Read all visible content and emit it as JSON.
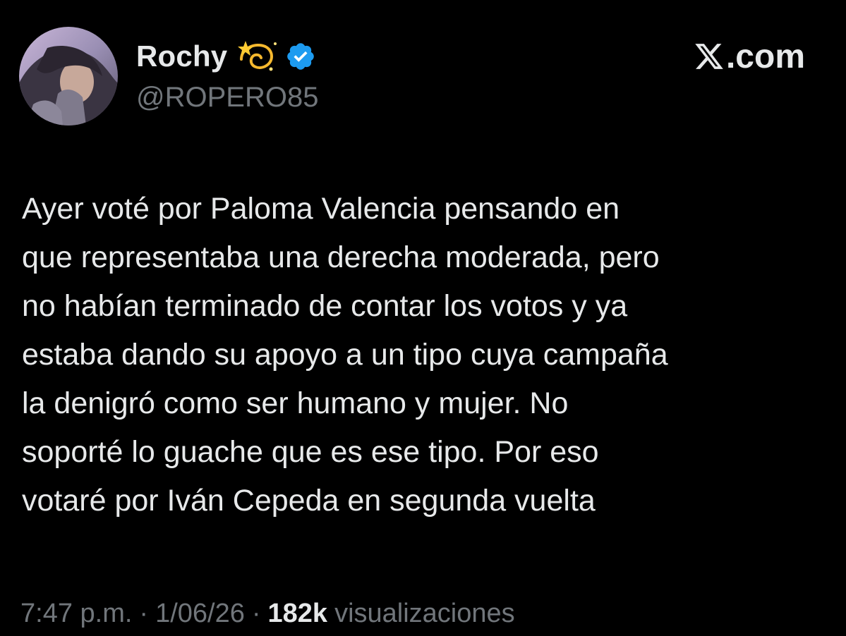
{
  "user": {
    "display_name": "Rochy",
    "handle": "@ROPERO85",
    "emoji_icon": "dizzy-star-emoji",
    "verified": true,
    "verified_color": "#1d9bf0"
  },
  "brand": {
    "label": ".com",
    "icon": "x-logo-icon"
  },
  "tweet": {
    "text": "Ayer voté por Paloma Valencia pensando en\nque representaba una derecha moderada, pero\nno habían terminado de contar los votos y ya\nestaba dando su apoyo a un tipo cuya campaña\nla denigró como ser humano y mujer. No\nsoporté lo guache que es ese tipo. Por eso\nvotaré por Iván Cepeda en segunda vuelta"
  },
  "meta": {
    "time": "7:47 p.m.",
    "separator": "·",
    "date": "1/06/26",
    "views_count": "182k",
    "views_label": "visualizaciones"
  },
  "colors": {
    "background": "#000000",
    "primary_text": "#e7e9ea",
    "secondary_text": "#71767b"
  }
}
